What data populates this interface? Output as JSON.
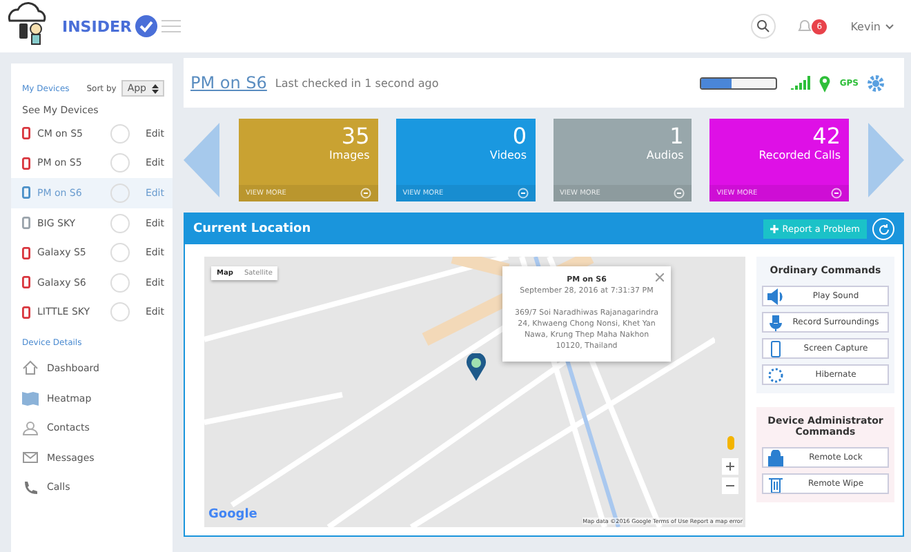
{
  "brand": {
    "name": "INSIDER"
  },
  "topbar": {
    "notification_count": "6",
    "user": "Kevin"
  },
  "sidebar": {
    "my_devices_label": "My Devices",
    "sort_label": "Sort by",
    "sort_value": "App",
    "see_all": "See My Devices",
    "devices": [
      {
        "name": "CM on S5",
        "color": "#d9363e",
        "selected": false,
        "action": "Edit"
      },
      {
        "name": "PM on S5",
        "color": "#d9363e",
        "selected": false,
        "action": "Edit"
      },
      {
        "name": "PM on S6",
        "color": "#4a90c8",
        "selected": true,
        "action": "Edit"
      },
      {
        "name": "BIG SKY",
        "color": "#9aa3ab",
        "selected": false,
        "action": "Edit"
      },
      {
        "name": "Galaxy S5",
        "color": "#d9363e",
        "selected": false,
        "action": "Edit"
      },
      {
        "name": "Galaxy S6",
        "color": "#d9363e",
        "selected": false,
        "action": "Edit"
      },
      {
        "name": "LITTLE SKY",
        "color": "#d9363e",
        "selected": false,
        "action": "Edit"
      }
    ],
    "details_label": "Device Details",
    "menu": [
      {
        "label": "Dashboard",
        "kind": "home"
      },
      {
        "label": "Heatmap",
        "kind": "map"
      },
      {
        "label": "Contacts",
        "kind": "person"
      },
      {
        "label": "Messages",
        "kind": "mail"
      },
      {
        "label": "Calls",
        "kind": "phone"
      }
    ]
  },
  "header": {
    "device": "PM on S6",
    "status": "Last checked in 1 second ago",
    "battery": {
      "level": 0.4
    },
    "gps_label": "GPS"
  },
  "tiles": [
    {
      "count": "35",
      "label": "Images",
      "footer": "VIEW MORE",
      "color": "#c9a232"
    },
    {
      "count": "0",
      "label": "Videos",
      "footer": "VIEW MORE",
      "color": "#1a98e0"
    },
    {
      "count": "1",
      "label": "Audios",
      "footer": "VIEW MORE",
      "color": "#98a7ab"
    },
    {
      "count": "42",
      "label": "Recorded Calls",
      "footer": "VIEW MORE",
      "color": "#de10e6"
    }
  ],
  "location": {
    "title": "Current Location",
    "report_button": "Report a Problem",
    "map_types": [
      {
        "label": "Map",
        "selected": true
      },
      {
        "label": "Satellite",
        "selected": false
      }
    ],
    "popup": {
      "title": "PM on S6",
      "time": "September 28, 2016 at 7:31:37 PM",
      "address": "369/7 Soi Naradhiwas Rajanagarindra 24, Khwaeng Chong Nonsi, Khet Yan Nawa, Krung Thep Maha Nakhon 10120, Thailand"
    },
    "map_logo": "Google",
    "map_footer": "Map data ©2016 Google   Terms of Use   Report a map error"
  },
  "commands": {
    "ordinary_title": "Ordinary Commands",
    "ordinary": [
      {
        "label": "Play Sound",
        "kind": "sound"
      },
      {
        "label": "Record Surroundings",
        "kind": "mic"
      },
      {
        "label": "Screen Capture",
        "kind": "phone"
      },
      {
        "label": "Hibernate",
        "kind": "spinner"
      }
    ],
    "admin_title": "Device Administrator Commands",
    "admin": [
      {
        "label": "Remote Lock",
        "kind": "lock"
      },
      {
        "label": "Remote Wipe",
        "kind": "trash"
      }
    ]
  }
}
